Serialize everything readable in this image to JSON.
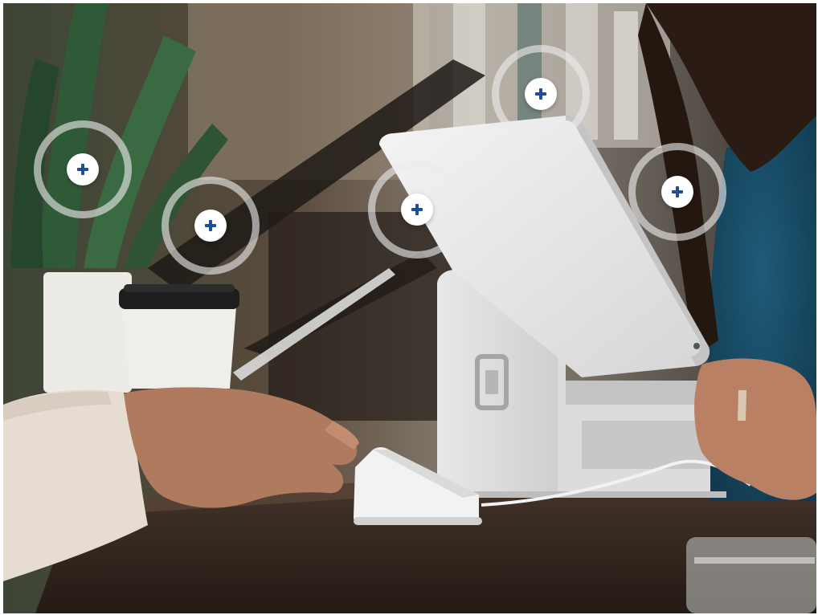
{
  "scene": {
    "description_icon": "point-of-sale-photo",
    "accent_color": "#1f4e99"
  },
  "hotspots": [
    {
      "id": "plant",
      "icon": "plus-icon"
    },
    {
      "id": "coffee-cup",
      "icon": "plus-icon"
    },
    {
      "id": "tablet-screen",
      "icon": "plus-icon"
    },
    {
      "id": "tablet-top",
      "icon": "plus-icon"
    },
    {
      "id": "customer-side",
      "icon": "plus-icon"
    }
  ]
}
